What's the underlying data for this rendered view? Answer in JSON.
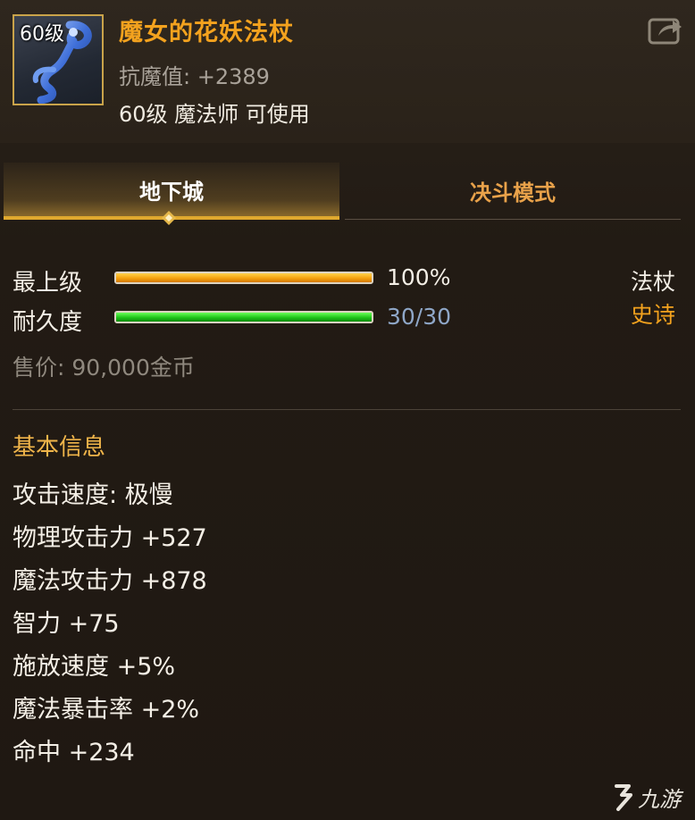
{
  "item": {
    "level_badge": "60级",
    "name": "魔女的花妖法杖",
    "resist_label": "抗魔值:",
    "resist_value": "+2389",
    "requirement": "60级 魔法师 可使用",
    "icon": "staff-icon"
  },
  "share_icon": "share-icon",
  "tabs": [
    {
      "label": "地下城",
      "active": true
    },
    {
      "label": "决斗模式",
      "active": false
    }
  ],
  "stats": {
    "grade_label": "最上级",
    "grade_value": "100%",
    "grade_fill": 1.0,
    "durability_label": "耐久度",
    "durability_value": "30/30",
    "durability_fill": 1.0,
    "type": "法杖",
    "rarity": "史诗",
    "price": "售价: 90,000金币"
  },
  "colors": {
    "accent_gold": "#f3a21e",
    "grade_bar": "#f4a10e",
    "durability_bar": "#20c41a",
    "durability_text": "#8fa7c8",
    "section_title": "#f0b54a"
  },
  "basic_info": {
    "title": "基本信息",
    "attributes": [
      "攻击速度: 极慢",
      "物理攻击力 +527",
      "魔法攻击力 +878",
      "智力 +75",
      "施放速度 +5%",
      "魔法暴击率 +2%",
      "命中 +234"
    ]
  },
  "watermark": {
    "text": "九游",
    "logo": "jiuyou-logo-icon"
  }
}
